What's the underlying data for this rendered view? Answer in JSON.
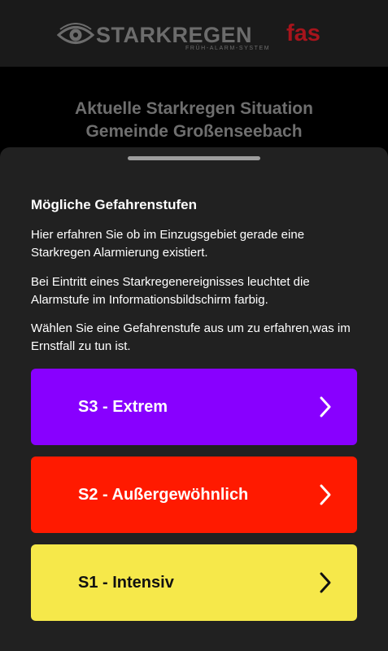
{
  "header": {
    "logo_word": "STARKREGEN",
    "logo_suffix": "fas",
    "logo_subtitle": "FRÜH-ALARM-SYSTEM",
    "logo_icon": "eye-icon"
  },
  "situation": {
    "line1": "Aktuelle Starkregen Situation",
    "line2": "Gemeinde Großenseebach"
  },
  "sheet": {
    "heading": "Mögliche Gefahrenstufen",
    "paragraphs": [
      "Hier erfahren Sie ob im Einzugsgebiet gerade eine Starkregen Alarmierung existiert.",
      "Bei Eintritt eines Starkregenereignisses leuchtet die Alarmstufe im Informationsbildschirm farbig.",
      "Wählen Sie eine Gefahrenstufe aus um zu erfahren,was im Ernstfall zu tun ist."
    ],
    "levels": [
      {
        "label": "S3 - Extrem",
        "color": "#8800ff",
        "text_color": "#ffffff",
        "icon": "chevron-right-icon"
      },
      {
        "label": "S2 - Außergewöhnlich",
        "color": "#ff1a00",
        "text_color": "#ffffff",
        "icon": "chevron-right-icon"
      },
      {
        "label": "S1 - Intensiv",
        "color": "#f6e84a",
        "text_color": "#111111",
        "icon": "chevron-right-icon"
      }
    ]
  },
  "colors": {
    "background": "#000000",
    "header_bg": "#1a1a1a",
    "sheet_bg": "#212121",
    "logo_gray": "#6c6c6c",
    "logo_red": "#a6141c"
  }
}
